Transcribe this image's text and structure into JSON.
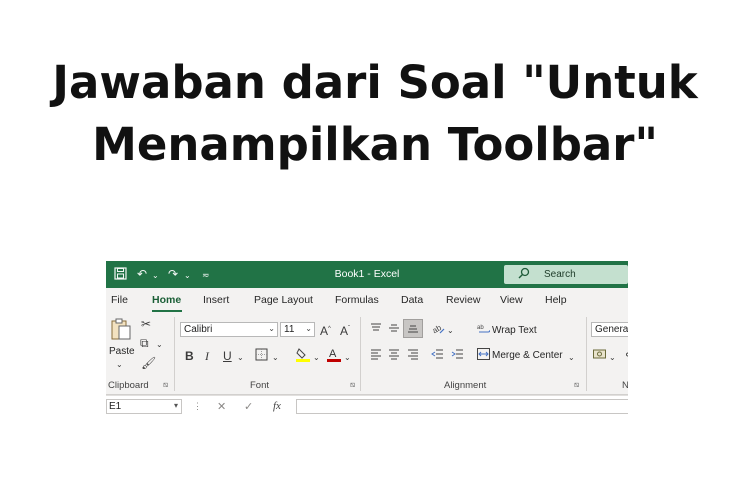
{
  "headline": {
    "line1": "Jawaban dari Soal \"Untuk",
    "line2": "Menampilkan Toolbar\""
  },
  "excel": {
    "title": "Book1 - Excel",
    "search_placeholder": "Search",
    "tabs": [
      "File",
      "Home",
      "Insert",
      "Page Layout",
      "Formulas",
      "Data",
      "Review",
      "View",
      "Help"
    ],
    "active_tab": "Home",
    "clipboard": {
      "paste_label": "Paste",
      "group_label": "Clipboard"
    },
    "font": {
      "name": "Calibri",
      "size": "11",
      "group_label": "Font",
      "font_color": "#c00000",
      "fill_color": "#ffff00"
    },
    "alignment": {
      "wrap_text_label": "Wrap Text",
      "merge_label": "Merge & Center",
      "group_label": "Alignment"
    },
    "number": {
      "format": "General",
      "group_label_partial": "N"
    },
    "name_box": "E1",
    "theme_color": "#217346"
  }
}
